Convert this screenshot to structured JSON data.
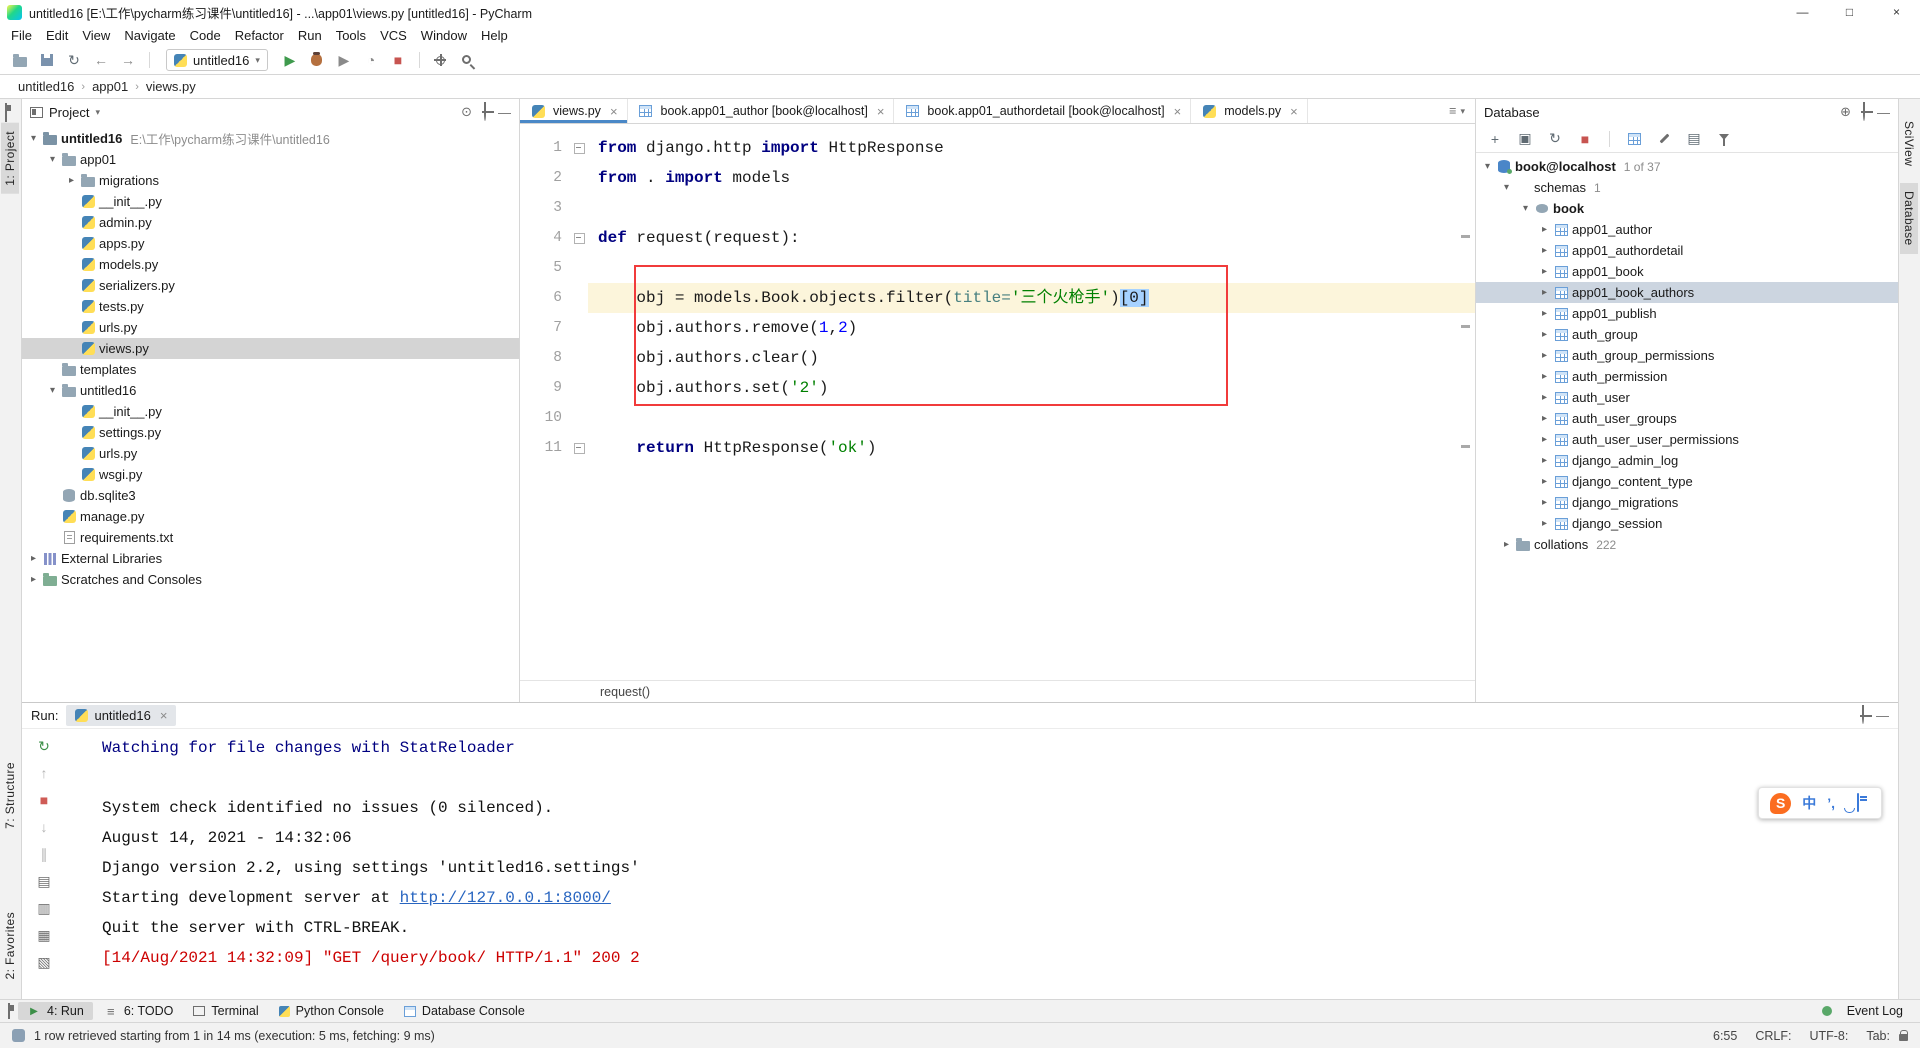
{
  "colors": {
    "annotation_box": "#f13b3b",
    "selection": "#a6d2ff",
    "keyword": "#000080",
    "string": "#008000",
    "number": "#0000ff",
    "named_param": "#467f7f",
    "link": "#2865c0",
    "console_error": "#cc0000",
    "console_info": "#000080",
    "current_line": "#fcf5db",
    "selected_row": "#d4d4d4"
  },
  "titlebar": {
    "title": "untitled16 [E:\\工作\\pycharm练习课件\\untitled16] - ...\\app01\\views.py [untitled16] - PyCharm"
  },
  "menubar": [
    "File",
    "Edit",
    "View",
    "Navigate",
    "Code",
    "Refactor",
    "Run",
    "Tools",
    "VCS",
    "Window",
    "Help"
  ],
  "toolbar": {
    "run_config": "untitled16"
  },
  "breadcrumbs": [
    "untitled16",
    "app01",
    "views.py"
  ],
  "stripes": {
    "left_top": "1: Project",
    "left_mid": "7: Structure",
    "left_bottom": "2: Favorites",
    "right_top": "SciView",
    "right_mid": "Database"
  },
  "project": {
    "header": "Project",
    "items": [
      {
        "indent": 0,
        "arrow": "down",
        "icon": "project",
        "label": "untitled16",
        "sub": "E:\\工作\\pycharm练习课件\\untitled16",
        "bold": true
      },
      {
        "indent": 1,
        "arrow": "down",
        "icon": "folder",
        "label": "app01"
      },
      {
        "indent": 2,
        "arrow": "right",
        "icon": "folder",
        "label": "migrations"
      },
      {
        "indent": 2,
        "icon": "py",
        "label": "__init__.py"
      },
      {
        "indent": 2,
        "icon": "py",
        "label": "admin.py"
      },
      {
        "indent": 2,
        "icon": "py",
        "label": "apps.py"
      },
      {
        "indent": 2,
        "icon": "py",
        "label": "models.py"
      },
      {
        "indent": 2,
        "icon": "py",
        "label": "serializers.py"
      },
      {
        "indent": 2,
        "icon": "py",
        "label": "tests.py"
      },
      {
        "indent": 2,
        "icon": "py",
        "label": "urls.py"
      },
      {
        "indent": 2,
        "icon": "py",
        "label": "views.py",
        "selected": true
      },
      {
        "indent": 1,
        "icon": "folder",
        "label": "templates"
      },
      {
        "indent": 1,
        "arrow": "down",
        "icon": "folder",
        "label": "untitled16"
      },
      {
        "indent": 2,
        "icon": "py",
        "label": "__init__.py"
      },
      {
        "indent": 2,
        "icon": "py",
        "label": "settings.py"
      },
      {
        "indent": 2,
        "icon": "py",
        "label": "urls.py"
      },
      {
        "indent": 2,
        "icon": "py",
        "label": "wsgi.py"
      },
      {
        "indent": 1,
        "icon": "db",
        "label": "db.sqlite3"
      },
      {
        "indent": 1,
        "icon": "py",
        "label": "manage.py"
      },
      {
        "indent": 1,
        "icon": "txt",
        "label": "requirements.txt"
      },
      {
        "indent": 0,
        "arrow": "right",
        "icon": "lib",
        "label": "External Libraries"
      },
      {
        "indent": 0,
        "arrow": "right",
        "icon": "scratch",
        "label": "Scratches and Consoles"
      }
    ]
  },
  "editor": {
    "tabs": [
      {
        "label": "views.py",
        "icon": "py",
        "active": true
      },
      {
        "label": "book.app01_author [book@localhost]",
        "icon": "table"
      },
      {
        "label": "book.app01_authordetail [book@localhost]",
        "icon": "table"
      },
      {
        "label": "models.py",
        "icon": "py"
      }
    ],
    "context": "request()",
    "lines": [
      {
        "n": 1,
        "fold": true,
        "tokens": [
          [
            "kw",
            "from"
          ],
          [
            "pl",
            " django.http "
          ],
          [
            "kw",
            "import"
          ],
          [
            "pl",
            " HttpResponse"
          ]
        ]
      },
      {
        "n": 2,
        "tokens": [
          [
            "kw",
            "from"
          ],
          [
            "pl",
            " . "
          ],
          [
            "kw",
            "import"
          ],
          [
            "pl",
            " models"
          ]
        ]
      },
      {
        "n": 3,
        "tokens": []
      },
      {
        "n": 4,
        "fold": true,
        "tokens": [
          [
            "kw",
            "def"
          ],
          [
            "pl",
            " request(request):"
          ]
        ]
      },
      {
        "n": 5,
        "tokens": []
      },
      {
        "n": 6,
        "current": true,
        "tokens": [
          [
            "pl",
            "    obj = models.Book.objects.filter("
          ],
          [
            "par",
            "title="
          ],
          [
            "str",
            "'三个火枪手'"
          ],
          [
            "pl",
            ")"
          ],
          [
            "sel",
            "[0]"
          ]
        ]
      },
      {
        "n": 7,
        "tokens": [
          [
            "pl",
            "    obj.authors.remove("
          ],
          [
            "num",
            "1"
          ],
          [
            "pl",
            ","
          ],
          [
            "num",
            "2"
          ],
          [
            "pl",
            ")"
          ]
        ]
      },
      {
        "n": 8,
        "tokens": [
          [
            "pl",
            "    obj.authors.clear()"
          ]
        ]
      },
      {
        "n": 9,
        "tokens": [
          [
            "pl",
            "    obj.authors.set("
          ],
          [
            "str",
            "'2'"
          ],
          [
            "pl",
            ")"
          ]
        ]
      },
      {
        "n": 10,
        "tokens": []
      },
      {
        "n": 11,
        "fold": true,
        "tokens": [
          [
            "pl",
            "    "
          ],
          [
            "kw",
            "return"
          ],
          [
            "pl",
            " HttpResponse("
          ],
          [
            "str",
            "'ok'"
          ],
          [
            "pl",
            ")"
          ]
        ]
      }
    ]
  },
  "database": {
    "header": "Database",
    "items": [
      {
        "indent": 0,
        "arrow": "down",
        "icon": "dbhost",
        "label": "book@localhost",
        "badge": "1 of 37",
        "bold": true
      },
      {
        "indent": 1,
        "arrow": "down",
        "icon": "none",
        "label": "schemas",
        "badge": "1"
      },
      {
        "indent": 2,
        "arrow": "down",
        "icon": "schema",
        "label": "book",
        "bold": true
      },
      {
        "indent": 3,
        "arrow": "right",
        "icon": "table",
        "label": "app01_author"
      },
      {
        "indent": 3,
        "arrow": "right",
        "icon": "table",
        "label": "app01_authordetail"
      },
      {
        "indent": 3,
        "arrow": "right",
        "icon": "table",
        "label": "app01_book"
      },
      {
        "indent": 3,
        "arrow": "right",
        "icon": "table",
        "label": "app01_book_authors",
        "selected": true
      },
      {
        "indent": 3,
        "arrow": "right",
        "icon": "table",
        "label": "app01_publish"
      },
      {
        "indent": 3,
        "arrow": "right",
        "icon": "table",
        "label": "auth_group"
      },
      {
        "indent": 3,
        "arrow": "right",
        "icon": "table",
        "label": "auth_group_permissions"
      },
      {
        "indent": 3,
        "arrow": "right",
        "icon": "table",
        "label": "auth_permission"
      },
      {
        "indent": 3,
        "arrow": "right",
        "icon": "table",
        "label": "auth_user"
      },
      {
        "indent": 3,
        "arrow": "right",
        "icon": "table",
        "label": "auth_user_groups"
      },
      {
        "indent": 3,
        "arrow": "right",
        "icon": "table",
        "label": "auth_user_user_permissions"
      },
      {
        "indent": 3,
        "arrow": "right",
        "icon": "table",
        "label": "django_admin_log"
      },
      {
        "indent": 3,
        "arrow": "right",
        "icon": "table",
        "label": "django_content_type"
      },
      {
        "indent": 3,
        "arrow": "right",
        "icon": "table",
        "label": "django_migrations"
      },
      {
        "indent": 3,
        "arrow": "right",
        "icon": "table",
        "label": "django_session"
      },
      {
        "indent": 1,
        "arrow": "right",
        "icon": "folder",
        "label": "collations",
        "badge": "222"
      }
    ]
  },
  "run": {
    "label": "Run:",
    "tab": "untitled16",
    "console": [
      {
        "cls": "cl-navy",
        "text": "Watching for file changes with StatReloader"
      },
      {
        "cls": "",
        "text": ""
      },
      {
        "cls": "",
        "text": "System check identified no issues (0 silenced)."
      },
      {
        "cls": "",
        "text": "August 14, 2021 - 14:32:06"
      },
      {
        "cls": "",
        "text": "Django version 2.2, using settings 'untitled16.settings'"
      },
      {
        "cls": "",
        "text": "Starting development server at ",
        "link": "http://127.0.0.1:8000/"
      },
      {
        "cls": "",
        "text": "Quit the server with CTRL-BREAK."
      },
      {
        "cls": "cl-red",
        "text": "[14/Aug/2021 14:32:09] \"GET /query/book/ HTTP/1.1\" 200 2"
      }
    ]
  },
  "sogou": {
    "logo": "S",
    "mode": "中",
    "punct": "’,"
  },
  "toolwindow_bar": {
    "left": [
      {
        "id": "run",
        "label": "4: Run",
        "active": true
      },
      {
        "id": "todo",
        "label": "6: TODO"
      },
      {
        "id": "terminal",
        "label": "Terminal"
      },
      {
        "id": "python",
        "label": "Python Console"
      },
      {
        "id": "dbconsole",
        "label": "Database Console"
      }
    ],
    "event_log": "Event Log"
  },
  "statusbar": {
    "message": "1 row retrieved starting from 1 in 14 ms (execution: 5 ms, fetching: 9 ms)",
    "right": [
      "6:55",
      "CRLF:",
      "UTF-8:",
      "Tab:"
    ]
  }
}
